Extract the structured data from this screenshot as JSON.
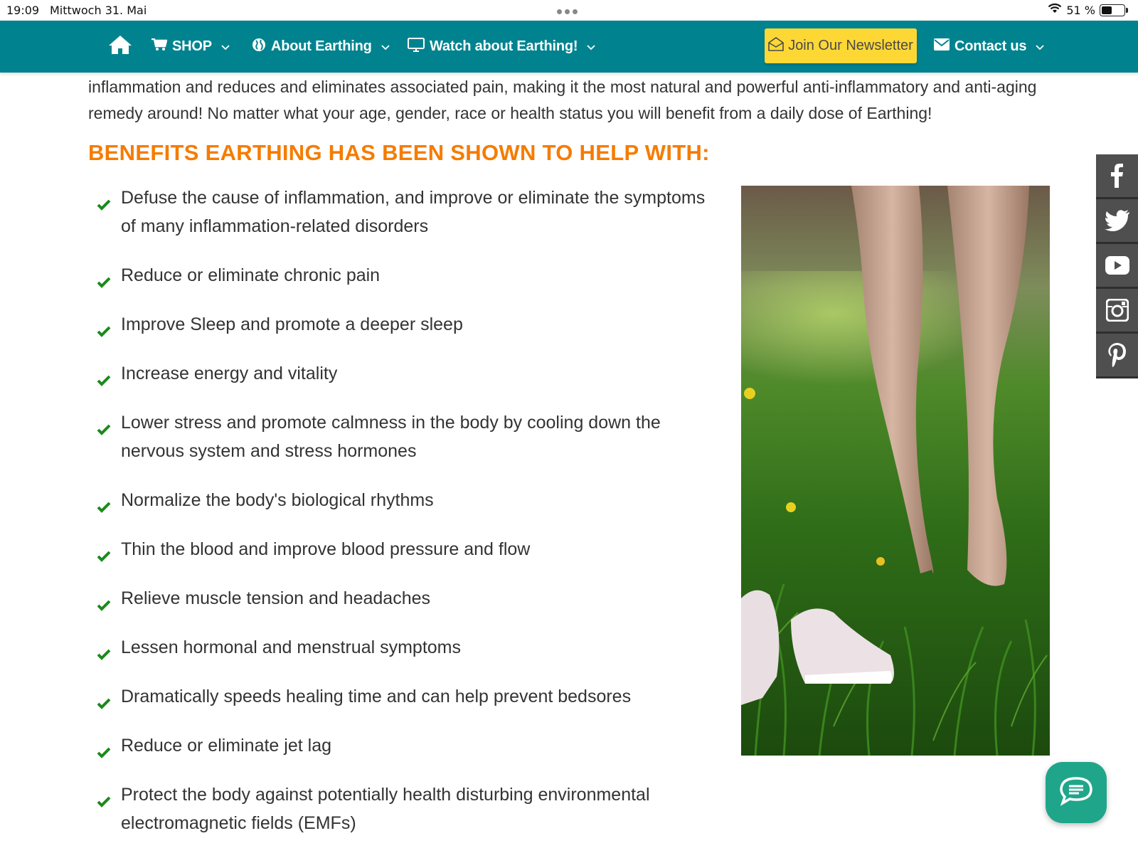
{
  "status_bar": {
    "time": "19:09",
    "date": "Mittwoch 31. Mai",
    "battery": "51 %",
    "battery_level": 0.51
  },
  "nav": {
    "home_icon": "home-icon",
    "shop": "SHOP",
    "about": "About Earthing",
    "watch": "Watch about Earthing!",
    "newsletter": "Join Our Newsletter",
    "contact": "Contact us",
    "bg_color": "#00838f",
    "newsletter_color": "#fdd835"
  },
  "intro": {
    "line1": "inflammation and reduces and eliminates associated pain, making it the most natural and powerful anti-inflammatory and anti-aging",
    "line2": "remedy around!  No matter what your age, gender, race or health status you will benefit from a daily dose of Earthing!"
  },
  "benefits": {
    "title": "BENEFITS EARTHING HAS BEEN SHOWN TO HELP WITH:",
    "title_color": "#f57c00",
    "check_color": "#1b8a1b",
    "items": [
      {
        "line1": "Defuse the cause of inflammation, and improve or eliminate the symptoms",
        "line2": "of many inflammation-related disorders"
      },
      {
        "line1": "Reduce or eliminate chronic pain",
        "line2": ""
      },
      {
        "line1": "Improve Sleep and promote a deeper sleep",
        "line2": ""
      },
      {
        "line1": "Increase energy and vitality",
        "line2": ""
      },
      {
        "line1": "Lower stress and promote calmness in the body by cooling down the",
        "line2": "nervous system and stress hormones"
      },
      {
        "line1": "Normalize the body's biological rhythms",
        "line2": ""
      },
      {
        "line1": "Thin the blood and improve blood pressure and flow",
        "line2": ""
      },
      {
        "line1": "Relieve muscle tension and headaches",
        "line2": ""
      },
      {
        "line1": "Lessen hormonal and menstrual symptoms",
        "line2": ""
      },
      {
        "line1": "Dramatically speeds healing time and can help prevent bedsores",
        "line2": ""
      },
      {
        "line1": "Reduce or eliminate jet lag",
        "line2": ""
      },
      {
        "line1": "Protect the body against potentially health disturbing environmental",
        "line2": "electromagnetic fields (EMFs)"
      }
    ]
  },
  "social": [
    "facebook-icon",
    "twitter-icon",
    "youtube-icon",
    "instagram-icon",
    "pinterest-icon"
  ],
  "chat": {
    "icon": "chat-icon",
    "color": "#1fa68a"
  }
}
